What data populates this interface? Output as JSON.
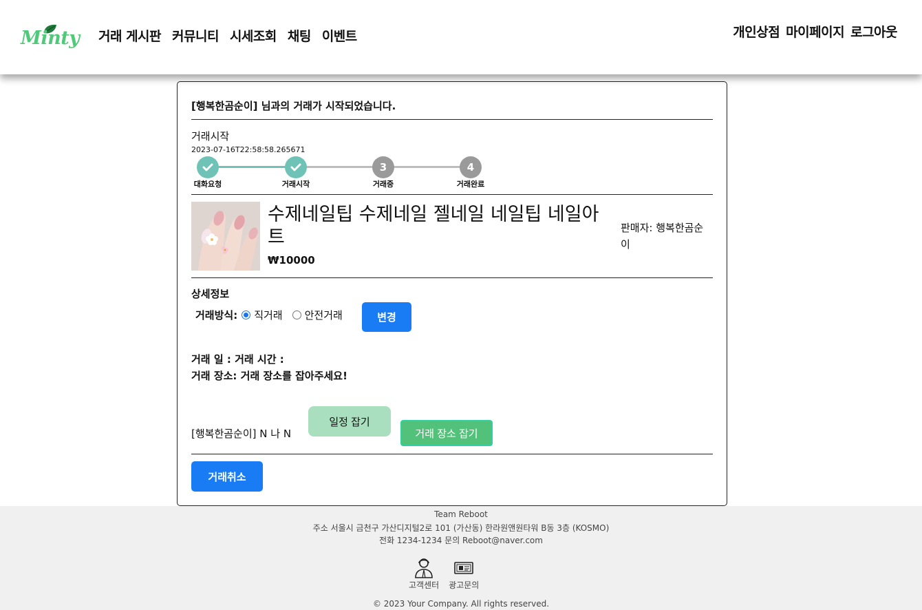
{
  "brand": {
    "logo_text": "Minty",
    "accent": "#52c97a"
  },
  "nav": {
    "left": [
      "거래 게시판",
      "커뮤니티",
      "시세조회",
      "채팅",
      "이벤트"
    ],
    "right": [
      "개인상점",
      "마이페이지",
      "로그아웃"
    ]
  },
  "trade": {
    "title": "[행복한곰순이] 님과의 거래가 시작되었습니다.",
    "status_label": "거래시작",
    "status_time": "2023-07-16T22:58:58.265671",
    "steps": [
      {
        "label": "대화요청",
        "state": "done",
        "number": "1"
      },
      {
        "label": "거래시작",
        "state": "done",
        "number": "2"
      },
      {
        "label": "거래중",
        "state": "todo",
        "number": "3"
      },
      {
        "label": "거래완료",
        "state": "todo",
        "number": "4"
      }
    ]
  },
  "product": {
    "title": "수제네일팁 수제네일 젤네일 네일팁 네일아트",
    "price": "₩10000",
    "seller": "판매자: 행복한곰순이"
  },
  "detail": {
    "title": "상세정보",
    "method_label": "거래방식:",
    "options": [
      "직거래",
      "안전거래"
    ],
    "selected_option": "직거래",
    "change_button": "변경",
    "date_line": "거래 일 : 거래 시간 :",
    "place_line": "거래 장소: 거래 장소를 잡아주세요!",
    "participants": "[행복한곰순이] N 나 N",
    "schedule_button": "일정 잡기",
    "place_button": "거래 장소 잡기",
    "cancel_button": "거래취소"
  },
  "footer": {
    "team": "Team Reboot",
    "address": "주소 서울시 금천구 가산디지털2로 101 (가산동) 한라원앤원타워 B동 3층 (KOSMO)",
    "contact": "전화 1234-1234 문의 Reboot@naver.com",
    "links": [
      {
        "label": "고객센터",
        "icon": "customer-service-icon"
      },
      {
        "label": "광고문의",
        "icon": "ad-inquiry-icon"
      }
    ],
    "copyright": "© 2023 Your Company. All rights reserved."
  }
}
